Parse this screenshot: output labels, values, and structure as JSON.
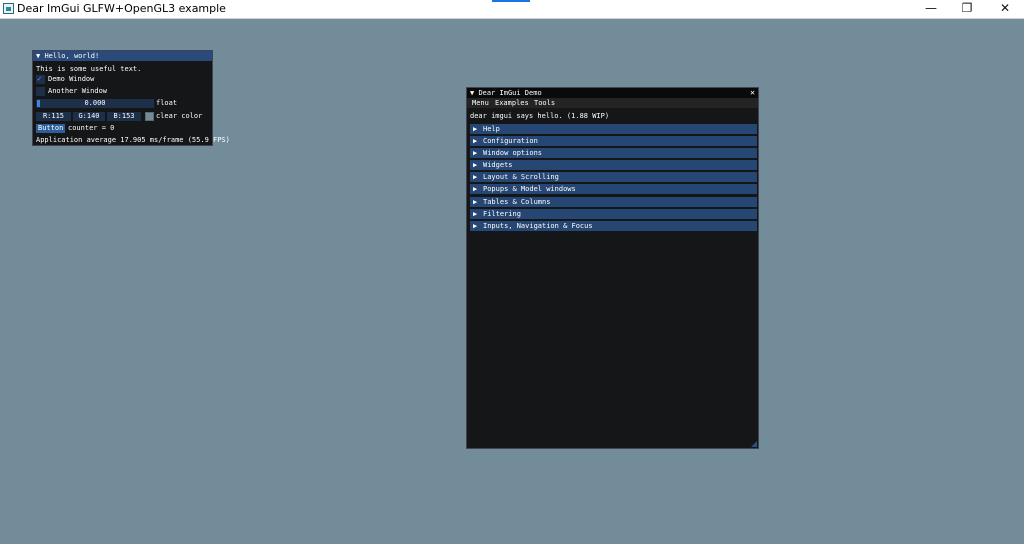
{
  "os": {
    "title": "Dear ImGui GLFW+OpenGL3 example",
    "min_icon": "—",
    "max_icon": "❐",
    "close_icon": "✕"
  },
  "hello": {
    "collapse_arrow": "▼",
    "title": "Hello, world!",
    "useful_text": "This is some useful text.",
    "demo_window_label": "Demo Window",
    "demo_window_checked": true,
    "check_glyph": "✓",
    "another_window_label": "Another Window",
    "float_value": "0.000",
    "float_label": "float",
    "r": "R:115",
    "g": "G:140",
    "b": "B:153",
    "clear_color_label": "clear color",
    "button_label": "Button",
    "counter": "counter = 0",
    "fps": "Application average 17.905 ms/frame (55.9 FPS)"
  },
  "demo": {
    "collapse_arrow": "▼",
    "title": "Dear ImGui Demo",
    "close_glyph": "✕",
    "menu": [
      "Menu",
      "Examples",
      "Tools"
    ],
    "says_hello": "dear imgui says hello. (1.88 WIP)",
    "header_arrow": "▶",
    "headers": [
      "Help",
      "Configuration",
      "Window options",
      "Widgets",
      "Layout & Scrolling",
      "Popups & Model windows",
      "Tables & Columns",
      "Filtering",
      "Inputs, Navigation & Focus"
    ]
  },
  "colors": {
    "background": "#738c99",
    "title_active": "#294a7a",
    "frame_bg": "#1d2f49",
    "header": "#264774",
    "check_mark": "#4296fa"
  }
}
